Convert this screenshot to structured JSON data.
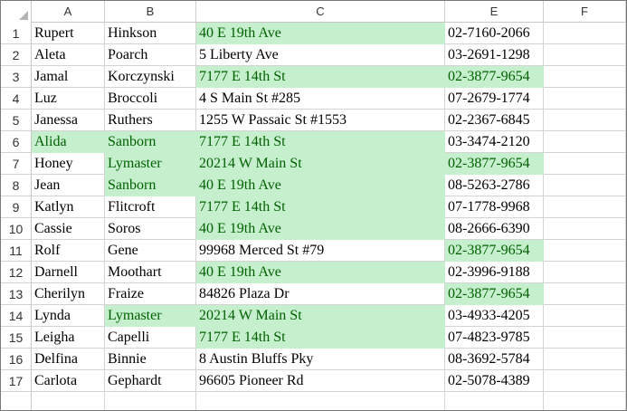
{
  "columns": [
    "A",
    "B",
    "C",
    "E",
    "F"
  ],
  "rows": [
    {
      "num": "1",
      "a": "Rupert",
      "b": "Hinkson",
      "c": "40 E 19th Ave",
      "e": "02-7160-2066",
      "hl": [
        false,
        false,
        true,
        false
      ]
    },
    {
      "num": "2",
      "a": "Aleta",
      "b": "Poarch",
      "c": "5 Liberty Ave",
      "e": "03-2691-1298",
      "hl": [
        false,
        false,
        false,
        false
      ]
    },
    {
      "num": "3",
      "a": "Jamal",
      "b": "Korczynski",
      "c": "7177 E 14th St",
      "e": "02-3877-9654",
      "hl": [
        false,
        false,
        true,
        true
      ]
    },
    {
      "num": "4",
      "a": "Luz",
      "b": "Broccoli",
      "c": "4 S Main St #285",
      "e": "07-2679-1774",
      "hl": [
        false,
        false,
        false,
        false
      ]
    },
    {
      "num": "5",
      "a": "Janessa",
      "b": "Ruthers",
      "c": "1255 W Passaic St #1553",
      "e": "02-2367-6845",
      "hl": [
        false,
        false,
        false,
        false
      ]
    },
    {
      "num": "6",
      "a": "Alida",
      "b": "Sanborn",
      "c": "7177 E 14th St",
      "e": "03-3474-2120",
      "hl": [
        true,
        true,
        true,
        false
      ]
    },
    {
      "num": "7",
      "a": "Honey",
      "b": "Lymaster",
      "c": "20214 W Main St",
      "e": "02-3877-9654",
      "hl": [
        false,
        true,
        true,
        true
      ]
    },
    {
      "num": "8",
      "a": "Jean",
      "b": "Sanborn",
      "c": "40 E 19th Ave",
      "e": "08-5263-2786",
      "hl": [
        false,
        true,
        true,
        false
      ]
    },
    {
      "num": "9",
      "a": "Katlyn",
      "b": "Flitcroft",
      "c": "7177 E 14th St",
      "e": "07-1778-9968",
      "hl": [
        false,
        false,
        true,
        false
      ]
    },
    {
      "num": "10",
      "a": "Cassie",
      "b": "Soros",
      "c": "40 E 19th Ave",
      "e": "08-2666-6390",
      "hl": [
        false,
        false,
        true,
        false
      ]
    },
    {
      "num": "11",
      "a": "Rolf",
      "b": "Gene",
      "c": "99968 Merced St #79",
      "e": "02-3877-9654",
      "hl": [
        false,
        false,
        false,
        true
      ]
    },
    {
      "num": "12",
      "a": "Darnell",
      "b": "Moothart",
      "c": "40 E 19th Ave",
      "e": "02-3996-9188",
      "hl": [
        false,
        false,
        true,
        false
      ]
    },
    {
      "num": "13",
      "a": "Cherilyn",
      "b": "Fraize",
      "c": "84826 Plaza Dr",
      "e": "02-3877-9654",
      "hl": [
        false,
        false,
        false,
        true
      ]
    },
    {
      "num": "14",
      "a": "Lynda",
      "b": "Lymaster",
      "c": "20214 W Main St",
      "e": "03-4933-4205",
      "hl": [
        false,
        true,
        true,
        false
      ]
    },
    {
      "num": "15",
      "a": "Leigha",
      "b": "Capelli",
      "c": "7177 E 14th St",
      "e": "07-4823-9785",
      "hl": [
        false,
        false,
        true,
        false
      ]
    },
    {
      "num": "16",
      "a": "Delfina",
      "b": "Binnie",
      "c": "8 Austin Bluffs Pky",
      "e": "08-3692-5784",
      "hl": [
        false,
        false,
        false,
        false
      ]
    },
    {
      "num": "17",
      "a": "Carlota",
      "b": "Gephardt",
      "c": "96605 Pioneer Rd",
      "e": "02-5078-4389",
      "hl": [
        false,
        false,
        false,
        false
      ]
    }
  ],
  "colors": {
    "highlight_fill": "#c6efce",
    "highlight_text": "#006100",
    "gridline": "#d4d4d4"
  }
}
